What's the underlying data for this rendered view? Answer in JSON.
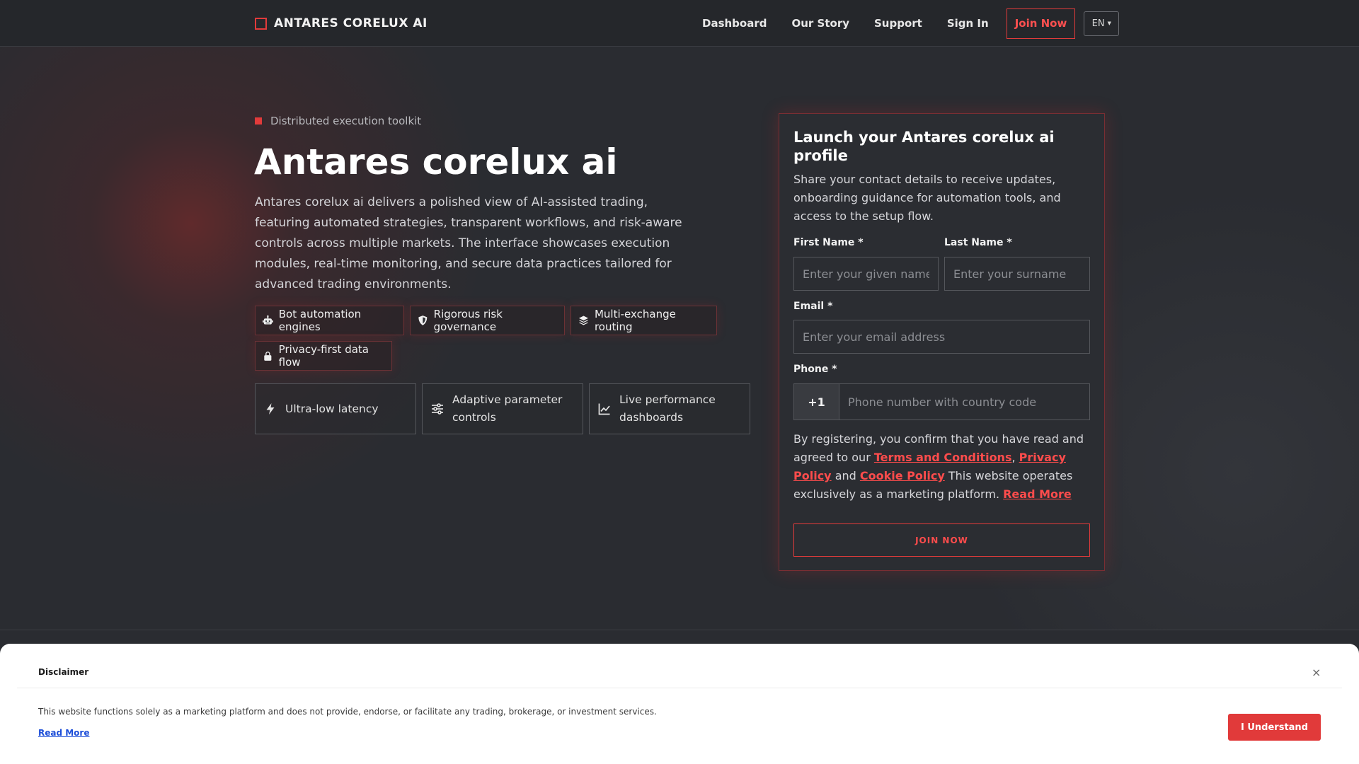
{
  "nav": {
    "brand": "ANTARES CORELUX AI",
    "links": [
      "Dashboard",
      "Our Story",
      "Support",
      "Sign In"
    ],
    "join": "Join Now",
    "language": "EN"
  },
  "hero": {
    "eyebrow": "Distributed execution toolkit",
    "title": "Antares corelux ai",
    "description": "Antares corelux ai delivers a polished view of AI-assisted trading, featuring automated strategies, transparent workflows, and risk-aware controls across multiple markets. The interface showcases execution modules, real-time monitoring, and secure data practices tailored for advanced trading environments.",
    "chips": [
      {
        "label": "Bot automation engines",
        "icon": "robot-icon"
      },
      {
        "label": "Rigorous risk governance",
        "icon": "shield-icon"
      },
      {
        "label": "Multi-exchange routing",
        "icon": "layers-icon"
      },
      {
        "label": "Privacy-first data flow",
        "icon": "lock-icon"
      }
    ],
    "features": [
      {
        "label": "Ultra-low latency",
        "icon": "bolt-icon"
      },
      {
        "label": "Adaptive parameter controls",
        "icon": "sliders-icon"
      },
      {
        "label": "Live performance dashboards",
        "icon": "chart-line-icon"
      }
    ]
  },
  "form": {
    "title": "Launch your Antares corelux ai profile",
    "subtitle": "Share your contact details to receive updates, onboarding guidance for automation tools, and access to the setup flow.",
    "first_name_label": "First Name *",
    "first_name_placeholder": "Enter your given name",
    "last_name_label": "Last Name *",
    "last_name_placeholder": "Enter your surname",
    "email_label": "Email *",
    "email_placeholder": "Enter your email address",
    "phone_label": "Phone *",
    "phone_prefix": "+1",
    "phone_placeholder": "Phone number with country code",
    "consent_before": "By registering, you confirm that you have read and agreed to our ",
    "terms": "Terms and Conditions",
    "comma": ", ",
    "privacy": "Privacy Policy",
    "and": " and ",
    "cookie": "Cookie Policy",
    "consent_after": " This website operates exclusively as a marketing platform. ",
    "read_more": "Read More",
    "submit": "JOIN NOW"
  },
  "disclaimer": {
    "title": "Disclaimer",
    "close": "×",
    "text": "This website functions solely as a marketing platform and does not provide, endorse, or facilitate any trading, brokerage, or investment services.",
    "read_more": "Read More",
    "button": "I Understand"
  },
  "colors": {
    "accent": "#e23b3b",
    "background": "#2a2c31",
    "nav_background": "#25272b",
    "disclaimer_button": "#e13a3a",
    "link_blue": "#1d4ed8"
  }
}
